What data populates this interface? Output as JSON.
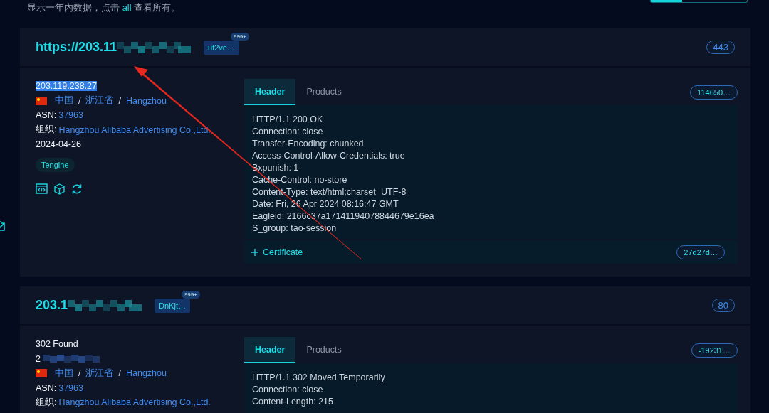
{
  "notice": "显示一年内数据，点击 **all** 查看所有。",
  "cards": [
    {
      "title": "https://203.11",
      "title_redacted": true,
      "tag": "uf2ve…",
      "tag_count": "999+",
      "port": "443",
      "details": [
        {
          "kind": "ip",
          "text": "203.119.238.27",
          "highlighted": true,
          "redacted": false
        },
        {
          "kind": "location",
          "country": "中国",
          "province": "浙江省",
          "city": "Hangzhou",
          "separators": [
            "/",
            "/"
          ]
        },
        {
          "kind": "field",
          "label": "ASN:",
          "value": "37963"
        },
        {
          "kind": "field",
          "label": "组织:",
          "value": "Hangzhou Alibaba Advertising Co.,Ltd."
        },
        {
          "kind": "text",
          "text": "2024-04-26"
        }
      ],
      "tech_tags": [
        "Tengine"
      ],
      "actions": true,
      "tabs": [
        {
          "label": "Header",
          "selected": true
        },
        {
          "label": "Products",
          "selected": false
        }
      ],
      "hash": "114650…",
      "header_lines": [
        "HTTP/1.1 200 OK",
        "Connection: close",
        "Transfer-Encoding: chunked",
        "Access-Control-Allow-Credentials: true",
        "Bxpunish: 1",
        "Cache-Control: no-store",
        "Content-Type: text/html;charset=UTF-8",
        "Date: Fri, 26 Apr 2024 08:16:47 GMT",
        "Eagleid: 2166c37a17141194078844679e16ea",
        "S_group: tao-session"
      ],
      "certificate": {
        "label": "Certificate",
        "hash": "27d27d…"
      }
    },
    {
      "title": "203.1",
      "title_redacted": true,
      "tag": "DnKjt…",
      "tag_count": "999+",
      "port": "80",
      "details": [
        {
          "kind": "text",
          "text": "302 Found"
        },
        {
          "kind": "ip",
          "text": "2",
          "highlighted": false,
          "redacted": true
        },
        {
          "kind": "location",
          "country": "中国",
          "province": "浙江省",
          "city": "Hangzhou",
          "separators": [
            "/",
            "/"
          ]
        },
        {
          "kind": "field",
          "label": "ASN:",
          "value": "37963"
        },
        {
          "kind": "field",
          "label": "组织:",
          "value": "Hangzhou Alibaba Advertising Co.,Ltd."
        }
      ],
      "tabs": [
        {
          "label": "Header",
          "selected": true
        },
        {
          "label": "Products",
          "selected": false
        }
      ],
      "hash": "-19231…",
      "header_lines": [
        "HTTP/1.1 302 Moved Temporarily",
        "Connection: close",
        "Content-Length: 215"
      ]
    }
  ]
}
